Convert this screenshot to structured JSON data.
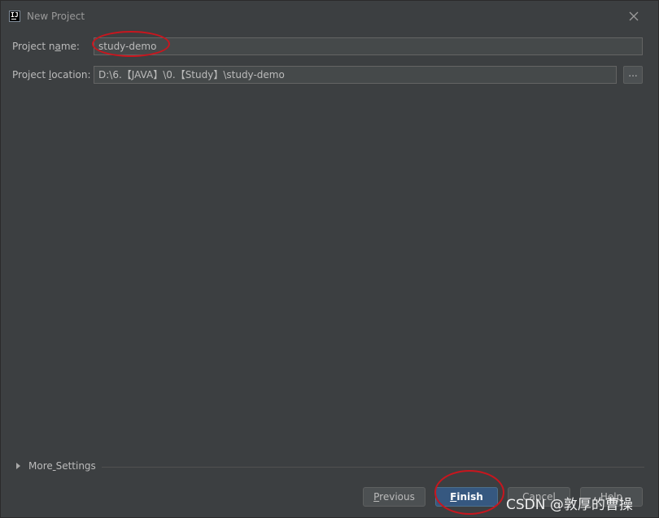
{
  "window": {
    "title": "New Project",
    "icon": "intellij-icon",
    "icon_text": "IJ"
  },
  "form": {
    "name_label_prefix": "Project n",
    "name_label_mnemonic": "a",
    "name_label_suffix": "me:",
    "name_value": "study-demo",
    "location_label_prefix": "Project ",
    "location_label_mnemonic": "l",
    "location_label_suffix": "ocation:",
    "location_value": "D:\\6.【JAVA】\\0.【Study】\\study-demo",
    "browse_label": "..."
  },
  "more_settings": {
    "label_prefix": "More",
    "label_mnemonic": " ",
    "label_suffix": "Settings"
  },
  "buttons": {
    "previous_mnemonic": "P",
    "previous_rest": "revious",
    "finish_mnemonic": "F",
    "finish_rest": "inish",
    "cancel_label": "Cancel",
    "help_label": "Help"
  },
  "watermark": "CSDN @敦厚的曹操",
  "colors": {
    "background": "#3c3f41",
    "field_background": "#45494a",
    "primary_button": "#365880",
    "annotation": "#c8161e"
  }
}
